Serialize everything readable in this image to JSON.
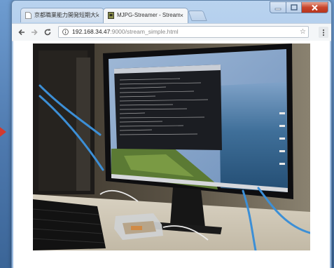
{
  "browser": {
    "tabs": [
      {
        "label": "京都職業能力開発短期大学校",
        "close": "×",
        "active": false
      },
      {
        "label": "MJPG-Streamer - Stream",
        "close": "×",
        "active": true
      }
    ],
    "address_bar": {
      "host": "192.168.34.47",
      "path": ":9000/stream_simple.html"
    },
    "bookmark_glyph": "☆",
    "icons": {
      "back": "back-arrow-icon",
      "forward": "forward-arrow-icon",
      "reload": "reload-icon",
      "page_info": "page-info-icon",
      "bookmark": "star-icon",
      "menu": "menu-dots-icon",
      "minimize": "minimize-icon",
      "maximize": "maximize-icon",
      "close": "close-icon"
    }
  },
  "content": {
    "stream_image": "webcam frame: monitor with terminal window and desktop wallpaper, Raspberry Pi in clear case, keyboard, blue network cables"
  },
  "colors": {
    "close_button": "#c8452c",
    "window_frame": "#a6c4e6",
    "side_arrow": "#d23a2f"
  }
}
